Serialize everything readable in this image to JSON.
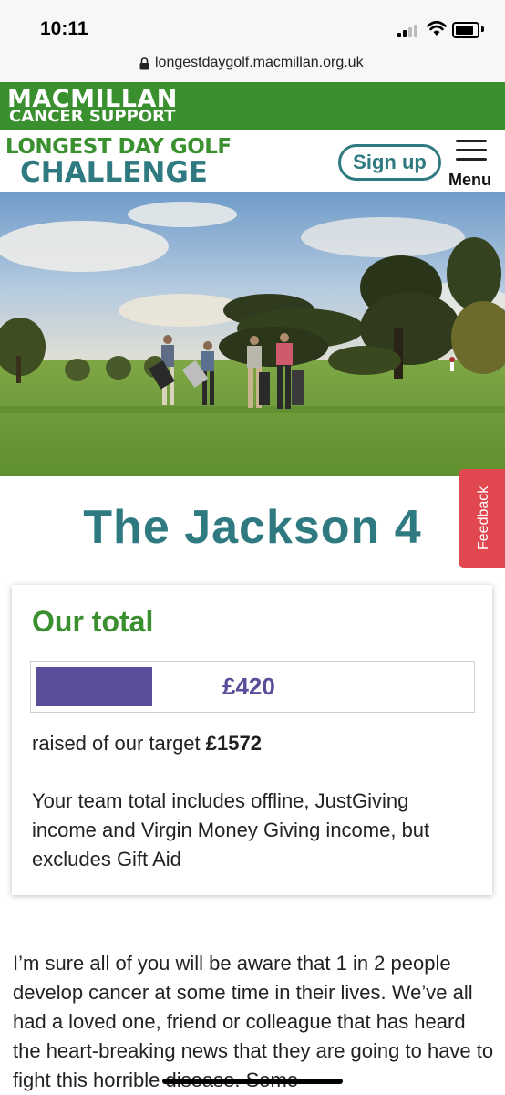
{
  "status_bar": {
    "time": "10:11"
  },
  "browser": {
    "url": "longestdaygolf.macmillan.org.uk"
  },
  "brand": {
    "name": "MACMILLAN",
    "subtitle": "CANCER SUPPORT",
    "color": "#3a8f2f"
  },
  "header": {
    "logo_line1": "LONGEST DAY GOLF",
    "logo_line2": "CHALLENGE",
    "signup_label": "Sign up",
    "menu_label": "Menu",
    "accent": "#2e7a80"
  },
  "feedback": {
    "label": "Feedback",
    "color": "#e0474f"
  },
  "team": {
    "name": "The Jackson 4"
  },
  "total": {
    "title": "Our total",
    "amount": "£420",
    "target": "£1572",
    "raised_prefix": "raised of our target",
    "progress_fraction": 0.267,
    "progress_color": "#5a4d9a",
    "note": "Your team total includes offline, JustGiving income and Virgin Money Giving income, but excludes Gift Aid"
  },
  "story": {
    "text": "I’m sure all of you will be aware that 1 in 2 people develop cancer at some time in their lives. We’ve all had a loved one, friend or colleague that has heard the heart-breaking news that they are going to have to fight this horrible disease. Some"
  }
}
